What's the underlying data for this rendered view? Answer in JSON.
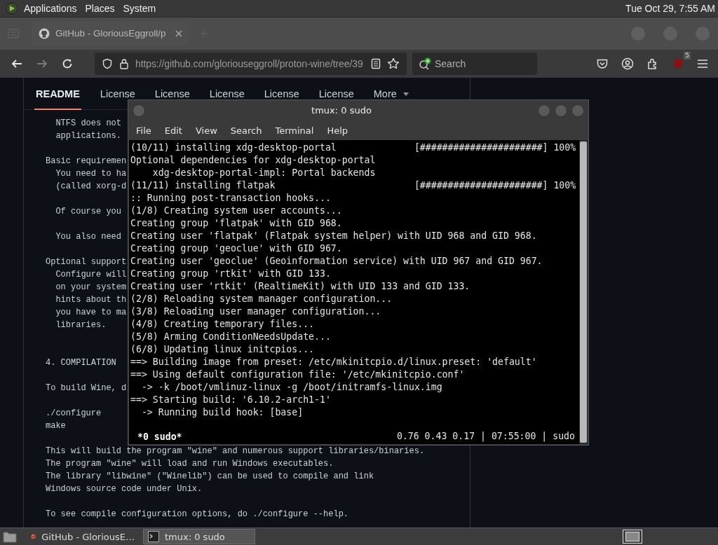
{
  "top_panel": {
    "menus": [
      "Applications",
      "Places",
      "System"
    ],
    "clock": "Tue Oct 29, 7:55 AM"
  },
  "browser": {
    "tabs": [
      {
        "title": "GitHub - GloriousEggroll/p",
        "selected": true
      }
    ],
    "forward_disabled": true,
    "url": "https://github.com/gloriouseggroll/proton-wine/tree/39",
    "search": {
      "placeholder": "Search"
    },
    "addon_badge": "5",
    "readme": {
      "tabs": [
        {
          "label": "README",
          "selected": true
        },
        {
          "label": "License",
          "selected": false
        },
        {
          "label": "License",
          "selected": false
        },
        {
          "label": "License",
          "selected": false
        },
        {
          "label": "License",
          "selected": false
        },
        {
          "label": "License",
          "selected": false
        }
      ],
      "more": "More",
      "paragraphs": [
        {
          "kind": "text",
          "lines": [
            "  NTFS does not",
            "  applications."
          ]
        },
        {
          "kind": "text",
          "lines": [
            "Basic requiremen",
            "  You need to ha",
            "  (called xorg-d"
          ]
        },
        {
          "kind": "text",
          "lines": [
            "  Of course you"
          ]
        },
        {
          "kind": "text",
          "lines": [
            "  You also need"
          ]
        },
        {
          "kind": "text",
          "lines": [
            "Optional support",
            "  Configure will",
            "  on your system",
            "  hints about th",
            "  you have to ma",
            "  libraries."
          ]
        },
        {
          "kind": "heading",
          "lines": [
            "4. COMPILATION"
          ]
        },
        {
          "kind": "text",
          "lines": [
            "To build Wine, d"
          ]
        },
        {
          "kind": "text",
          "lines": [
            "./configure",
            "make"
          ]
        },
        {
          "kind": "text",
          "lines": [
            "This will build the program \"wine\" and numerous support libraries/binaries.",
            "The program \"wine\" will load and run Windows executables.",
            "The library \"libwine\" (\"Winelib\") can be used to compile and link",
            "Windows source code under Unix."
          ]
        },
        {
          "kind": "text",
          "lines": [
            "To see compile configuration options, do ./configure --help."
          ]
        }
      ]
    }
  },
  "terminal": {
    "title": "tmux: 0 sudo",
    "menu": [
      "File",
      "Edit",
      "View",
      "Search",
      "Terminal",
      "Help"
    ],
    "lines": [
      "(10/11) installing xdg-desktop-portal              [######################] 100%",
      "Optional dependencies for xdg-desktop-portal",
      "    xdg-desktop-portal-impl: Portal backends",
      "(11/11) installing flatpak                         [######################] 100%",
      ":: Running post-transaction hooks...",
      "(1/8) Creating system user accounts...",
      "Creating group 'flatpak' with GID 968.",
      "Creating user 'flatpak' (Flatpak system helper) with UID 968 and GID 968.",
      "Creating group 'geoclue' with GID 967.",
      "Creating user 'geoclue' (Geoinformation service) with UID 967 and GID 967.",
      "Creating group 'rtkit' with GID 133.",
      "Creating user 'rtkit' (RealtimeKit) with UID 133 and GID 133.",
      "(2/8) Reloading system manager configuration...",
      "(3/8) Reloading user manager configuration...",
      "(4/8) Creating temporary files...",
      "(5/8) Arming ConditionNeedsUpdate...",
      "(6/8) Updating linux initcpios...",
      "==> Building image from preset: /etc/mkinitcpio.d/linux.preset: 'default'",
      "==> Using default configuration file: '/etc/mkinitcpio.conf'",
      "  -> -k /boot/vmlinuz-linux -g /boot/initramfs-linux.img",
      "==> Starting build: '6.10.2-arch1-1'",
      "  -> Running build hook: [base]"
    ],
    "status_left": "*0 sudo*",
    "status_right": "0.76 0.43 0.17 | 07:55:00 | sudo"
  },
  "taskbar": {
    "tasks": [
      {
        "kind": "browser",
        "title": "GitHub - GloriousE…",
        "selected": false
      },
      {
        "kind": "terminal",
        "title": "tmux: 0 sudo",
        "selected": true
      }
    ]
  }
}
